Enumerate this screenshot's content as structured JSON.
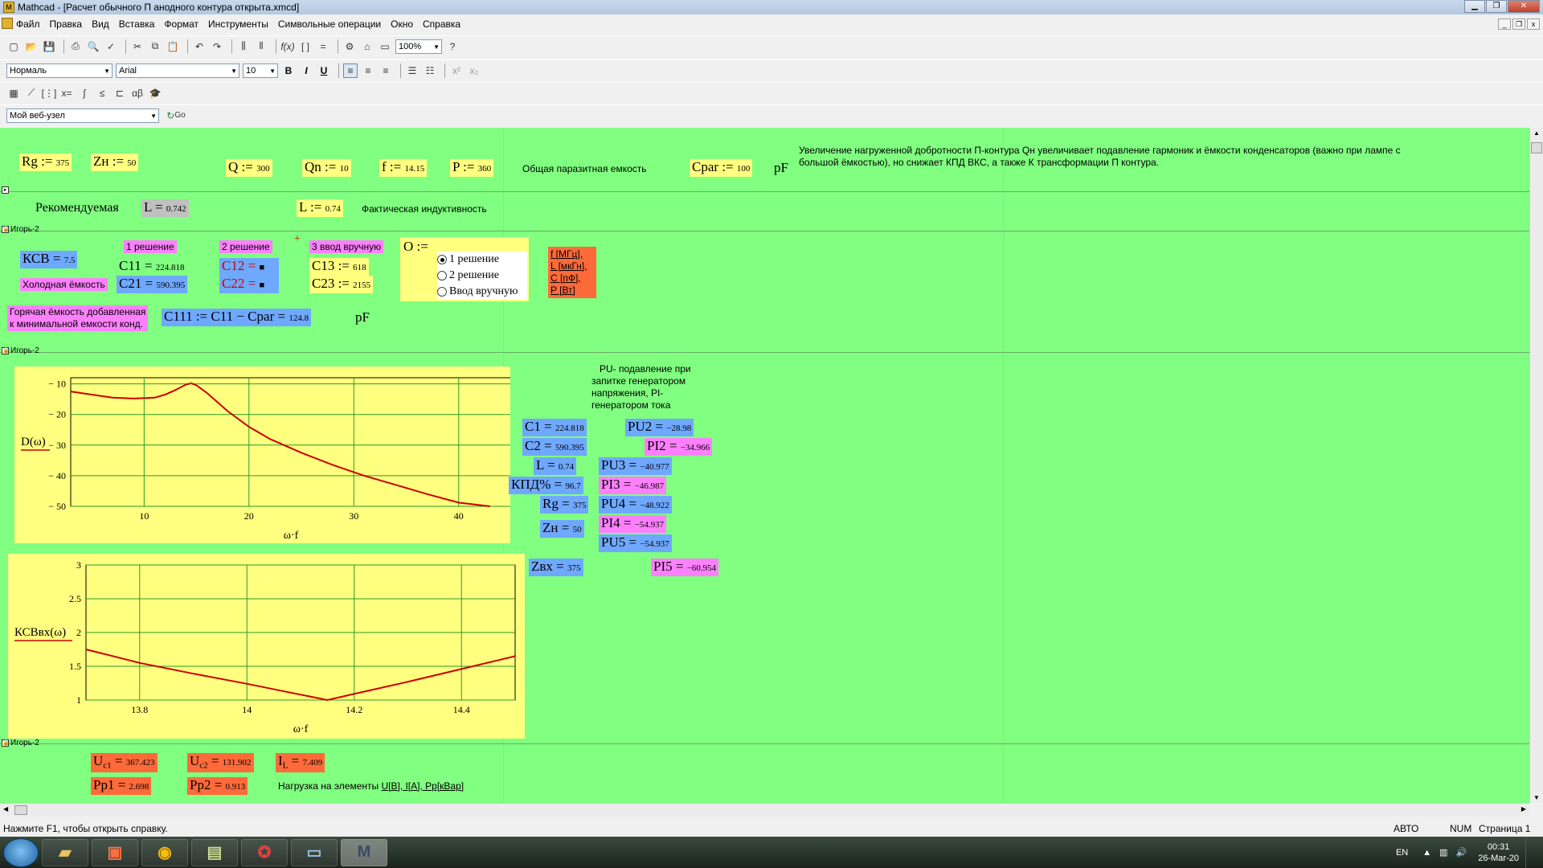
{
  "title": "Mathcad - [Расчет обычного П анодного контура открыта.xmcd]",
  "menu": [
    "Файл",
    "Правка",
    "Вид",
    "Вставка",
    "Формат",
    "Инструменты",
    "Символьные операции",
    "Окно",
    "Справка"
  ],
  "toolbar": {
    "zoom": "100%",
    "style": "Нормаль",
    "font": "Arial",
    "size": "10",
    "bold": "B",
    "italic": "I",
    "underline": "U",
    "web": "Мой веб-узел",
    "go": "Go"
  },
  "row1": {
    "rg": {
      "name": "Rg := ",
      "value": "375"
    },
    "zn": {
      "name": "Zн := ",
      "value": "50"
    },
    "q": {
      "name": "Q := ",
      "value": "300"
    },
    "qn": {
      "name": "Qn := ",
      "value": "10"
    },
    "f": {
      "name": "f := ",
      "value": "14.15"
    },
    "p": {
      "name": "P := ",
      "value": "360"
    },
    "cpar_label": "Общая паразитная емкость",
    "cpar": {
      "name": "Cpar := ",
      "value": "100"
    },
    "unit_pf": "pF",
    "note": "Увеличение нагруженной добротности П-контура Qн увеличивает подавление гармоник и ёмкости конденсаторов (важно при лампе с большой ёмкостью), но снижает КПД ВКС, а также К трансформации П контура."
  },
  "row2": {
    "recommended": "Рекомендуемая",
    "l": {
      "name": "L = ",
      "value": "0.742"
    },
    "l2": {
      "name": "L := ",
      "value": "0.74"
    },
    "actual": "Фактическая индуктивность"
  },
  "region_label": "Игорь-2",
  "row3": {
    "ksv": {
      "name": "КСВ = ",
      "value": "7.5"
    },
    "cold": "Холодная ёмкость",
    "sol1": "1 решение",
    "sol2": "2 решение",
    "sol3": "3 ввод вручную",
    "c11": {
      "name": "C11 = ",
      "value": "224.818"
    },
    "c21": {
      "name": "C21 = ",
      "value": "590.395"
    },
    "c12": {
      "name": "C12 = ",
      "value": "■"
    },
    "c22": {
      "name": "C22 = ",
      "value": "■"
    },
    "c13": {
      "name": "C13 := ",
      "value": "618"
    },
    "c23": {
      "name": "C23 := ",
      "value": "2155"
    },
    "o_name": "O :=",
    "radio": [
      "1 решение",
      "2 решение",
      "Ввод вручную"
    ],
    "units": [
      "f [МГц],",
      "L [мкГн],",
      "C [пФ],",
      "P [Вт]"
    ],
    "hot_label1": "Горячая ёмкость добавленная",
    "hot_label2": "к минимальной емкости конд.",
    "c111": {
      "name": "C111 := C11 − Cpar = ",
      "value": "124.8"
    },
    "unit_pf": "pF"
  },
  "results": {
    "pu_note": "PU- подавление при запитке генератором напряжения, PI- генератором тока",
    "c1": {
      "name": "C1 = ",
      "value": "224.818"
    },
    "c2": {
      "name": "C2 = ",
      "value": "590.395"
    },
    "l": {
      "name": "L = ",
      "value": "0.74"
    },
    "kpd": {
      "name": "КПД% = ",
      "value": "96.7"
    },
    "rg": {
      "name": "Rg = ",
      "value": "375"
    },
    "zn": {
      "name": "Zн = ",
      "value": "50"
    },
    "zvx": {
      "name": "Zвх = ",
      "value": "375"
    },
    "pu2": {
      "name": "PU2 = ",
      "value": "−28.98"
    },
    "pi2": {
      "name": "PI2 = ",
      "value": "−34.966"
    },
    "pu3": {
      "name": "PU3 = ",
      "value": "−40.977"
    },
    "pi3": {
      "name": "PI3 = ",
      "value": "−46.987"
    },
    "pu4": {
      "name": "PU4 = ",
      "value": "−48.922"
    },
    "pi4": {
      "name": "PI4 = ",
      "value": "−54.937"
    },
    "pu5": {
      "name": "PU5 = ",
      "value": "−54.937"
    },
    "pi5": {
      "name": "PI5 = ",
      "value": "−60.954"
    }
  },
  "bottom": {
    "uc1": {
      "name": "U",
      "sub": "c1",
      "eq": " = ",
      "value": "367.423"
    },
    "uc2": {
      "name": "U",
      "sub": "c2",
      "eq": " = ",
      "value": "131.902"
    },
    "il": {
      "name": "I",
      "sub": "L",
      "eq": " = ",
      "value": "7.409"
    },
    "pp1": {
      "name": "Pp1 = ",
      "value": "2.698"
    },
    "pp2": {
      "name": "Pp2 = ",
      "value": "0.913"
    },
    "load_note": "Нагрузка на элементы ",
    "load_units": "U[B], I[A], Pp[кВар]"
  },
  "status": {
    "help": "Нажмите F1, чтобы открыть справку.",
    "auto": "АВТО",
    "num": "NUM",
    "page": "Страница 1"
  },
  "tray": {
    "lang": "EN",
    "time": "00:31",
    "date": "26-Mar-20"
  },
  "chart_data": [
    {
      "type": "line",
      "ylabel": "D(ω)",
      "xlabel": "ω·f",
      "xlim": [
        3,
        45
      ],
      "ylim": [
        -50,
        -8
      ],
      "xticks": [
        10,
        20,
        30,
        40
      ],
      "yticks": [
        -10,
        -20,
        -30,
        -40,
        -50
      ],
      "grid": true,
      "series": [
        {
          "color": "#cc0000",
          "x": [
            3,
            5,
            7,
            9,
            11,
            12,
            13,
            14,
            14.5,
            15,
            16,
            17,
            18,
            20,
            22,
            25,
            28,
            31,
            34,
            37,
            40,
            43
          ],
          "y": [
            -12.5,
            -13.5,
            -14.5,
            -14.8,
            -14.5,
            -13.5,
            -12,
            -10.2,
            -9.8,
            -10.5,
            -13,
            -16,
            -19,
            -24,
            -28,
            -32.5,
            -36.5,
            -40,
            -43,
            -46,
            -48.8,
            -50
          ]
        }
      ]
    },
    {
      "type": "line",
      "ylabel": "КСВвх(ω)",
      "xlabel": "ω·f",
      "xlim": [
        13.7,
        14.5
      ],
      "ylim": [
        1,
        3
      ],
      "xticks": [
        13.8,
        14,
        14.2,
        14.4
      ],
      "yticks": [
        1,
        1.5,
        2,
        2.5,
        3
      ],
      "grid": true,
      "series": [
        {
          "color": "#cc0000",
          "x": [
            13.7,
            13.8,
            13.9,
            14,
            14.1,
            14.15,
            14.2,
            14.3,
            14.4,
            14.5
          ],
          "y": [
            1.75,
            1.55,
            1.39,
            1.24,
            1.08,
            1.0,
            1.09,
            1.27,
            1.46,
            1.65
          ]
        }
      ]
    }
  ]
}
